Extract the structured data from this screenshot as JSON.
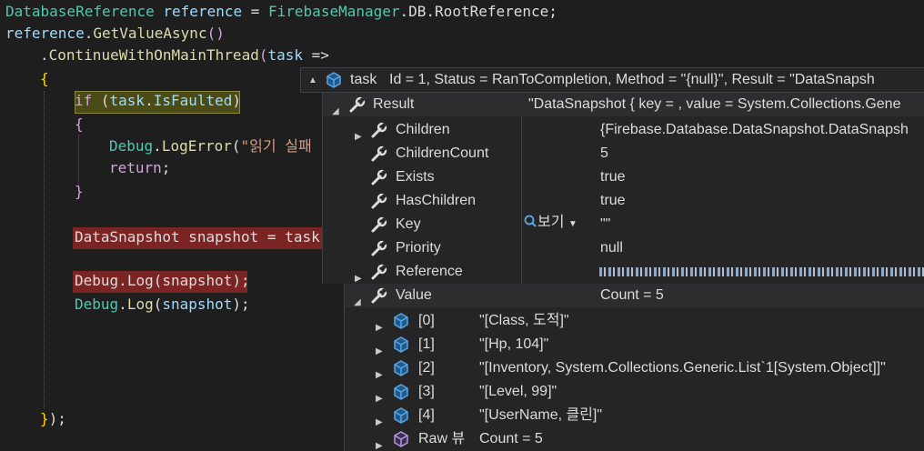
{
  "code": {
    "line1": {
      "type": "DatabaseReference",
      "var": "reference",
      "eq": " = ",
      "cls": "FirebaseManager",
      "rest": ".DB.RootReference;"
    },
    "line2": {
      "obj": "reference",
      "dot": ".",
      "method": "GetValueAsync",
      "paren": "()"
    },
    "line3": {
      "dot": ".",
      "method": "ContinueWithOnMainThread",
      "open": "(",
      "param": "task",
      "arrow": " =>"
    },
    "line4": {
      "brace": "{"
    },
    "line5": {
      "kw": "if",
      "text": " (",
      "obj": "task",
      ".": ".",
      "prop": "IsFaulted",
      "close": ")"
    },
    "line6": {
      "brace": "{"
    },
    "line7": {
      "cls": "Debug",
      "dot": ".",
      "method": "LogError",
      "open": "(",
      "str": "\"읽기 실패"
    },
    "line8": {
      "kw": "return",
      "semi": ";"
    },
    "line9": {
      "brace": "}"
    },
    "line10": {
      "type": "DataSnapshot",
      "var": " snapshot",
      "eq": " = ",
      "obj": "task."
    },
    "line11": {
      "cls": "Debug",
      "dot": ".",
      "method": "Log",
      "open": "(",
      "arg": "snapshot",
      "close": ");"
    },
    "line12": {
      "cls": "Debug",
      "dot": ".",
      "method": "Log",
      "open": "(",
      "arg": "snapshot",
      "close": ");"
    },
    "line13": {
      "brace": "}",
      "close": ");"
    }
  },
  "task_tip": {
    "label": "task",
    "detail": "Id = 1, Status = RanToCompletion, Method = \"{null}\", Result = \"DataSnapsh"
  },
  "result_tip": {
    "name": "Result",
    "value": "\"DataSnapshot { key = , value = System.Collections.Gene",
    "viewer_label": "보기",
    "rows": [
      {
        "name": "Children",
        "value": "{Firebase.Database.DataSnapshot.DataSnapsh"
      },
      {
        "name": "ChildrenCount",
        "value": "5"
      },
      {
        "name": "Exists",
        "value": "true"
      },
      {
        "name": "HasChildren",
        "value": "true"
      },
      {
        "name": "Key",
        "value": "\"\""
      },
      {
        "name": "Priority",
        "value": "null"
      },
      {
        "name": "Reference",
        "value": ""
      },
      {
        "name": "Value",
        "value": "Count = 5"
      }
    ]
  },
  "value_tip": {
    "rows": [
      {
        "index": "[0]",
        "value": "\"[Class, 도적]\""
      },
      {
        "index": "[1]",
        "value": "\"[Hp, 104]\""
      },
      {
        "index": "[2]",
        "value": "\"[Inventory, System.Collections.Generic.List`1[System.Object]]\""
      },
      {
        "index": "[3]",
        "value": "\"[Level, 99]\""
      },
      {
        "index": "[4]",
        "value": "\"[UserName, 클린]\""
      }
    ],
    "raw_label": "Raw 뷰",
    "raw_value": "Count = 5"
  },
  "colors": {
    "editor_bg": "#1e1e1e",
    "tip_bg": "#252526",
    "tip_row_header": "#2d2d30",
    "type": "#4ec9b0",
    "var": "#9cdcfe",
    "method": "#dcdcaa",
    "keyword": "#d8a0df",
    "string": "#d69d85",
    "error_highlight": "#7a2424"
  },
  "icons": {
    "task": "cube-icon",
    "property": "wrench-icon",
    "item": "cube-icon",
    "raw": "raw-view-icon",
    "magnifier": "magnifier-icon"
  }
}
